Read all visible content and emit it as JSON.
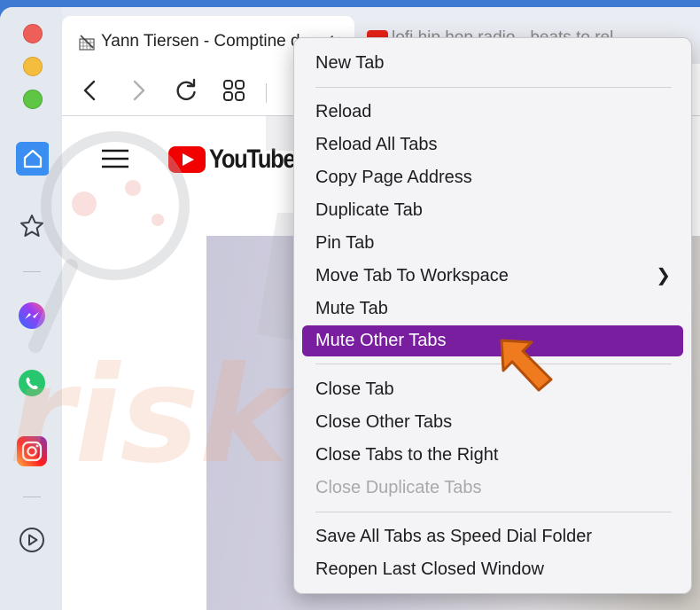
{
  "window": {
    "active_tab": {
      "title": "Yann Tiersen - Comptine d"
    },
    "other_tab": {
      "title": "lofi hip hop radio - beats to rel"
    }
  },
  "page": {
    "logo_text": "YouTube"
  },
  "context_menu": {
    "items": [
      {
        "label": "New Tab"
      },
      {
        "label": "Reload"
      },
      {
        "label": "Reload All Tabs"
      },
      {
        "label": "Copy Page Address"
      },
      {
        "label": "Duplicate Tab"
      },
      {
        "label": "Pin Tab"
      },
      {
        "label": "Move Tab To Workspace",
        "submenu": true
      },
      {
        "label": "Mute Tab"
      },
      {
        "label": "Mute Other Tabs",
        "highlighted": true
      },
      {
        "label": "Close Tab"
      },
      {
        "label": "Close Other Tabs"
      },
      {
        "label": "Close Tabs to the Right"
      },
      {
        "label": "Close Duplicate Tabs",
        "disabled": true
      },
      {
        "label": "Save All Tabs as Speed Dial Folder"
      },
      {
        "label": "Reopen Last Closed Window"
      }
    ]
  },
  "colors": {
    "menu_highlight": "#7a1ea0",
    "arrow": "#f07a1e",
    "window_background": "#3e7ad1"
  }
}
